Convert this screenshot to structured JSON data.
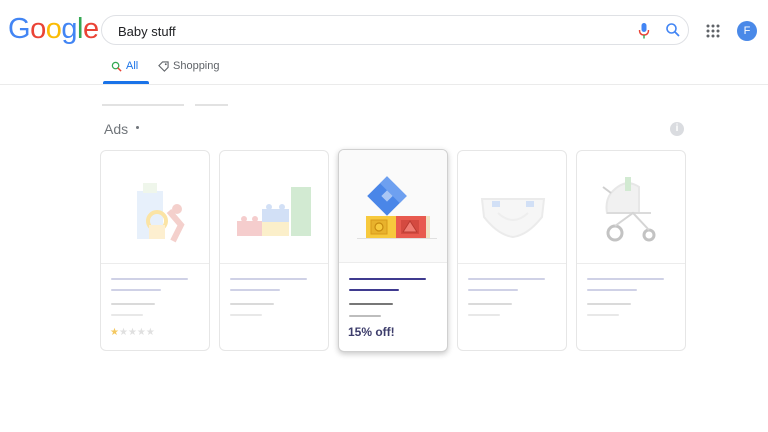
{
  "header": {
    "logo": [
      "G",
      "o",
      "o",
      "g",
      "l",
      "e"
    ],
    "logo_colors": [
      "#4285F4",
      "#EA4335",
      "#FBBC05",
      "#4285F4",
      "#34A853",
      "#EA4335"
    ],
    "search_value": "Baby stuff",
    "avatar_initial": "F"
  },
  "tabs": [
    {
      "label": "All",
      "icon": "search-icon",
      "active": true
    },
    {
      "label": "Shopping",
      "icon": "tag-icon",
      "active": false
    }
  ],
  "ads": {
    "label": "Ads",
    "info_icon": "i"
  },
  "products": [
    {
      "image": "baby-toy-image",
      "rating": 1,
      "max_rating": 5,
      "highlight": ""
    },
    {
      "image": "toy-blocks-image",
      "highlight": ""
    },
    {
      "image": "alphabet-blocks-image",
      "highlight": "15% off!"
    },
    {
      "image": "diaper-image",
      "highlight": ""
    },
    {
      "image": "stroller-image",
      "highlight": ""
    }
  ],
  "colors": {
    "accent": "#1a73e8",
    "highlight_text": "#3d3d6b",
    "active_lines": "#3f3a8f"
  }
}
